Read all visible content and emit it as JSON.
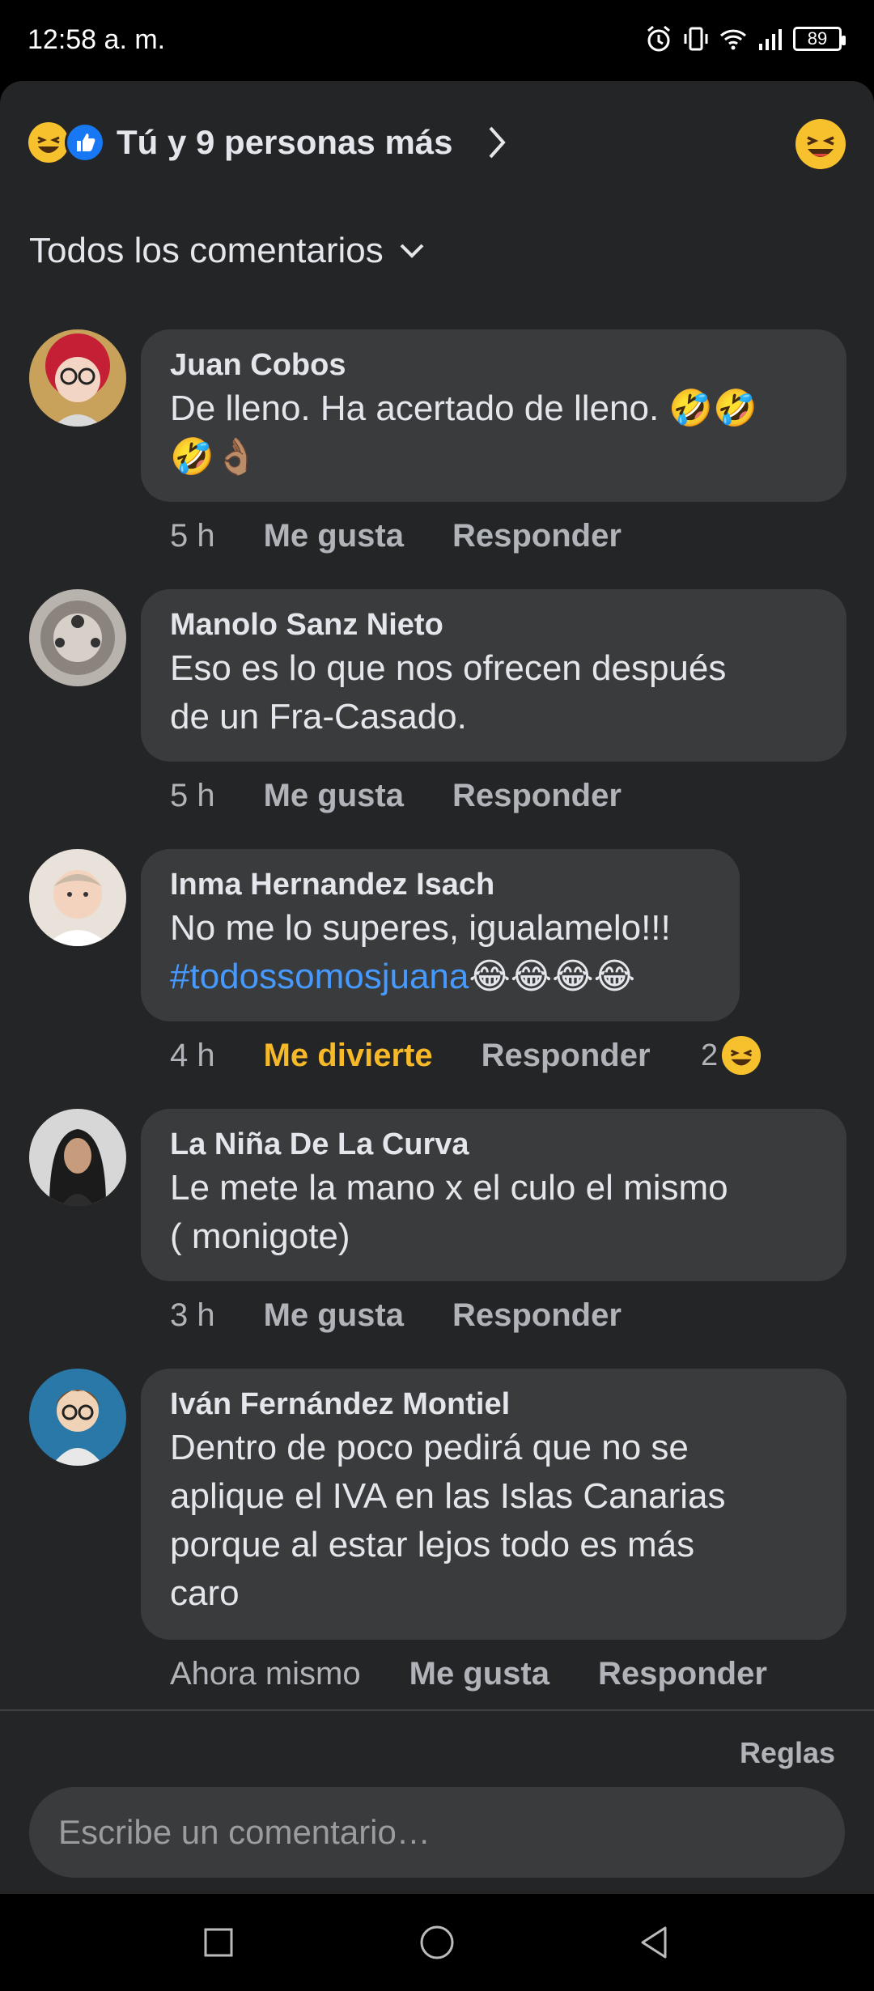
{
  "status": {
    "time": "12:58 a. m.",
    "battery": "89"
  },
  "header": {
    "reactions_text": "Tú y 9 personas más"
  },
  "sort": {
    "label": "Todos los comentarios"
  },
  "comments": [
    {
      "author": "Juan Cobos",
      "lines": [
        "De lleno. Ha acertado de lleno. 🤣🤣",
        "🤣👌🏽"
      ],
      "time": "5 h",
      "like": "Me gusta",
      "reply": "Responder"
    },
    {
      "author": "Manolo Sanz Nieto",
      "lines": [
        "Eso es lo que nos ofrecen después",
        "de un Fra-Casado."
      ],
      "time": "5 h",
      "like": "Me gusta",
      "reply": "Responder"
    },
    {
      "author": "Inma Hernandez Isach",
      "lines": [
        "No me lo superes, igualamelo!!!"
      ],
      "hashtag": "#todossomosjuana",
      "hashtag_emoji": "😂😂😂😂",
      "time": "4 h",
      "like": "Me divierte",
      "reply": "Responder",
      "reaction_count": "2"
    },
    {
      "author": "La Niña De La Curva",
      "lines": [
        "Le mete la mano x el culo el mismo",
        "( monigote)"
      ],
      "time": "3 h",
      "like": "Me gusta",
      "reply": "Responder"
    },
    {
      "author": "Iván Fernández Montiel",
      "lines": [
        "Dentro de poco pedirá que no se",
        "aplique el IVA en las Islas Canarias",
        "porque al estar lejos todo es más",
        "caro"
      ],
      "time": "Ahora mismo",
      "like": "Me gusta",
      "reply": "Responder"
    }
  ],
  "footer": {
    "rules": "Reglas",
    "composer_placeholder": "Escribe un comentario…"
  },
  "colors": {
    "background": "#242526",
    "bubble": "#3a3b3c",
    "accent_link": "#4599ff",
    "funny": "#f7b928",
    "like_blue": "#1877f2"
  },
  "icons": [
    "alarm-icon",
    "vibrate-icon",
    "wifi-icon",
    "signal-icon",
    "battery-icon",
    "laughing-emoji-icon",
    "like-icon",
    "chevron-right-icon",
    "chevron-down-icon",
    "square-nav-icon",
    "circle-nav-icon",
    "back-nav-icon"
  ]
}
